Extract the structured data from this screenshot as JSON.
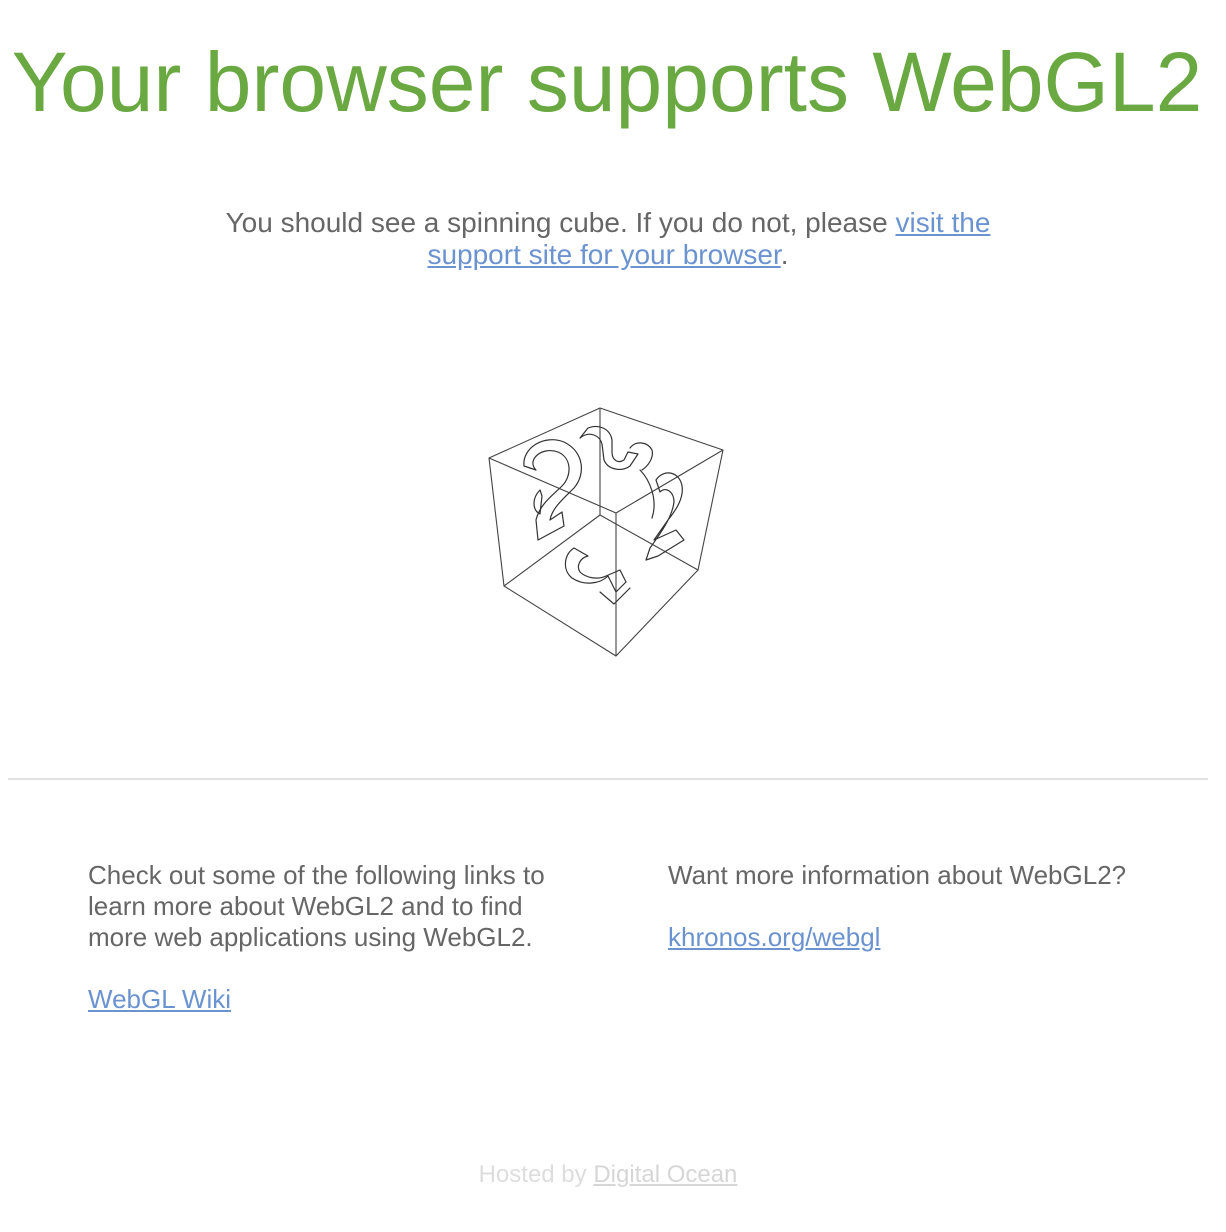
{
  "header": {
    "title": "Your browser supports WebGL2"
  },
  "intro": {
    "text_before": "You should see a spinning cube. If you do not, please ",
    "link_label": "visit the support site for your browser",
    "text_after": "."
  },
  "cube": {
    "icon": "webgl2-spinning-cube-icon",
    "face_glyph": "2"
  },
  "left_column": {
    "text": "Check out some of the following links to learn more about WebGL2 and to find more web applications using WebGL2.",
    "link_label": "WebGL Wiki"
  },
  "right_column": {
    "text": "Want more information about WebGL2?",
    "link_label": "khronos.org/webgl"
  },
  "footer": {
    "prefix": "Hosted by ",
    "link_label": "Digital Ocean"
  },
  "colors": {
    "title": "#6aa842",
    "link": "#6b93d0",
    "body_text": "#666666",
    "divider": "#e2e2e2",
    "footer_text": "#dddddd"
  }
}
